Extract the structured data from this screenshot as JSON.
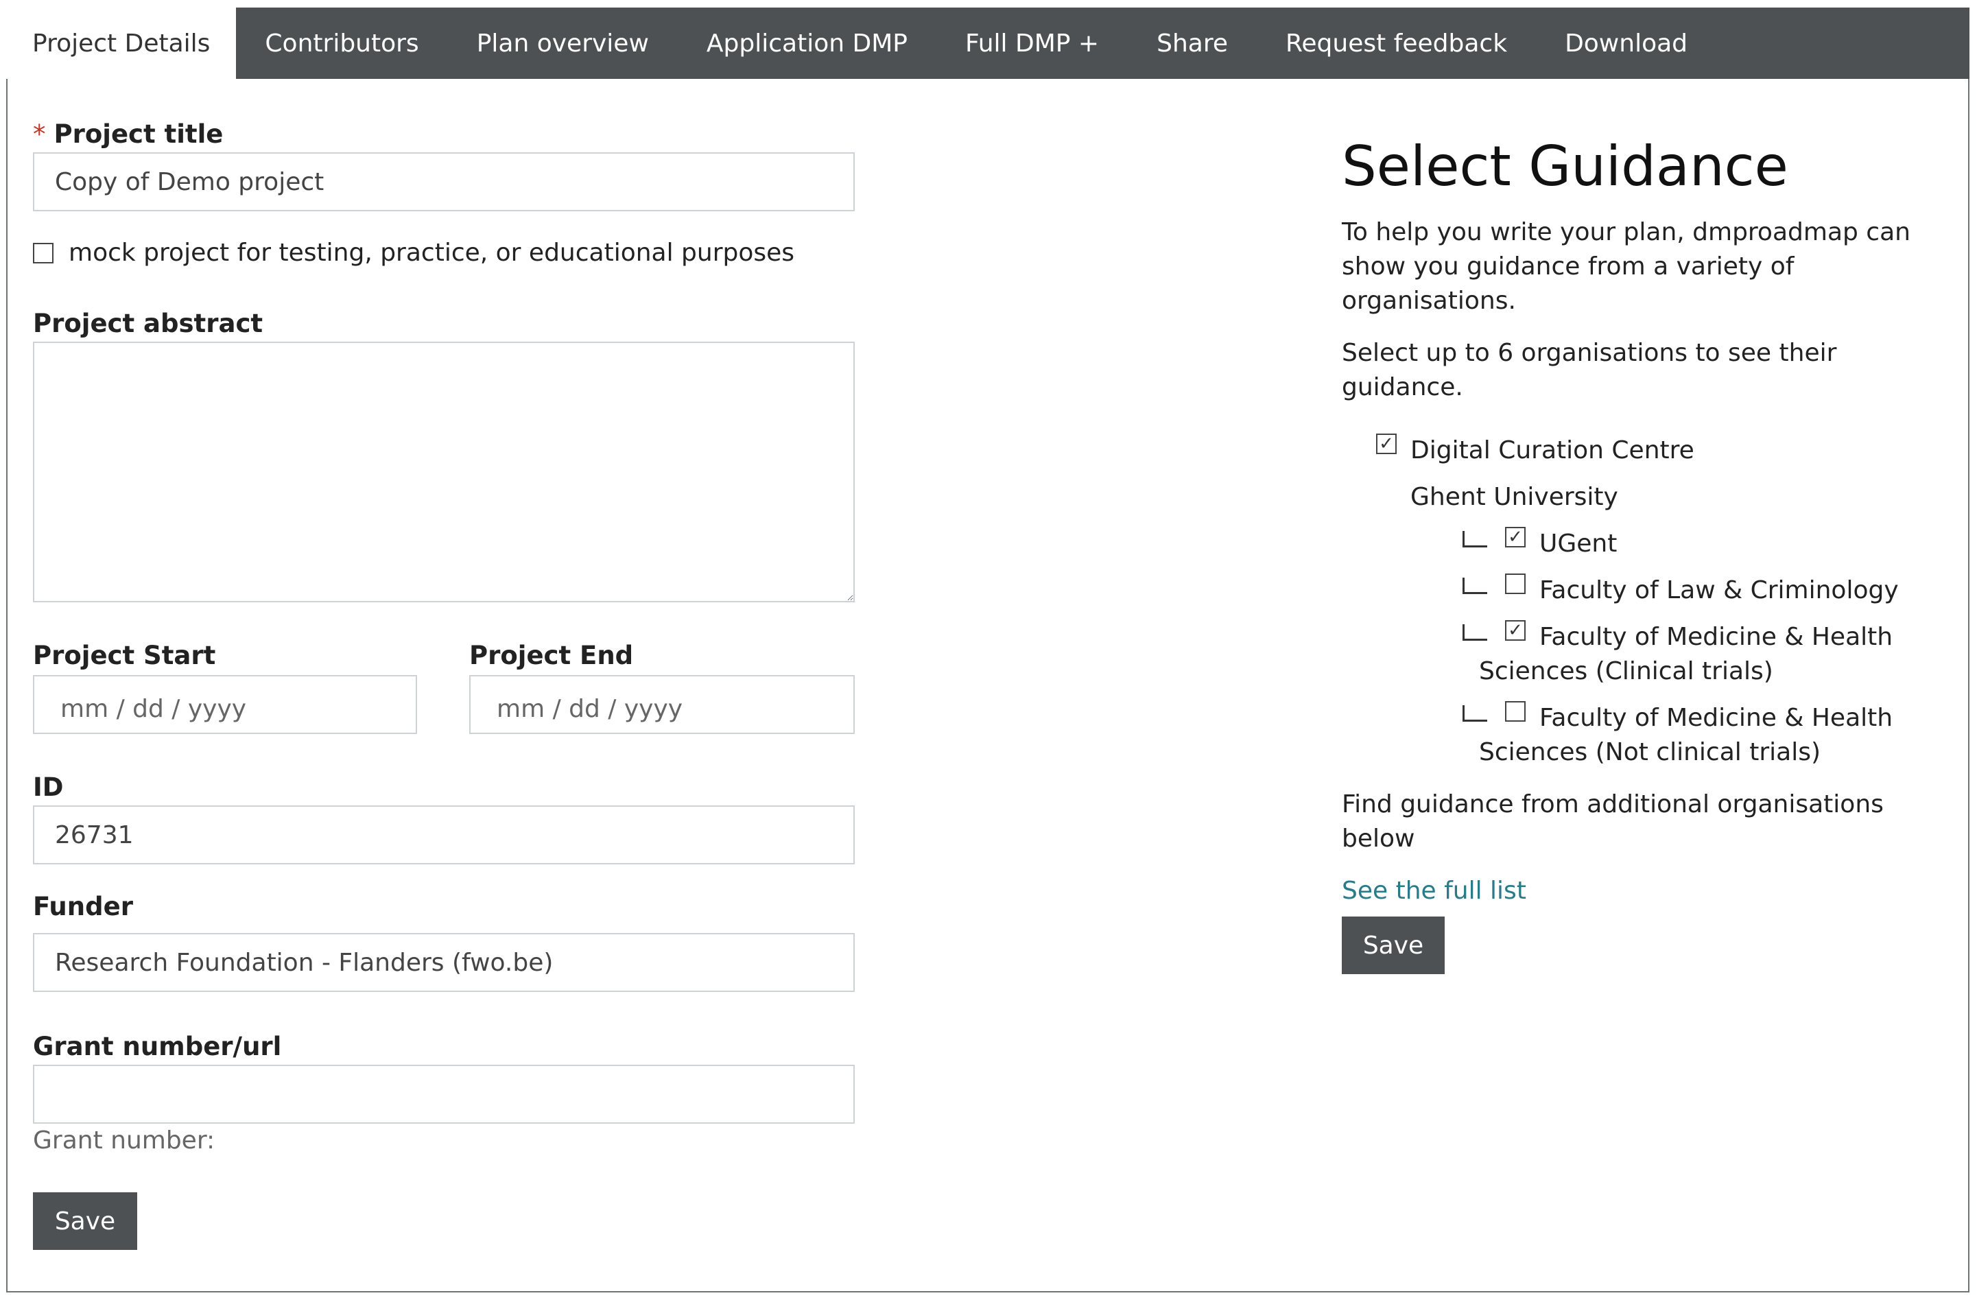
{
  "tabs": [
    {
      "label": "Project Details",
      "active": true
    },
    {
      "label": "Contributors"
    },
    {
      "label": "Plan overview"
    },
    {
      "label": "Application DMP"
    },
    {
      "label": "Full DMP +"
    },
    {
      "label": "Share"
    },
    {
      "label": "Request feedback"
    },
    {
      "label": "Download"
    }
  ],
  "project_form": {
    "required_marker": "*",
    "title_label": "Project title",
    "title_value": "Copy of Demo project",
    "mock_checkbox_label": "mock project for testing, practice, or educational purposes",
    "abstract_label": "Project abstract",
    "start_label": "Project Start",
    "start_placeholder": "mm / dd / yyyy",
    "end_label": "Project End",
    "end_placeholder": "mm / dd / yyyy",
    "id_label": "ID",
    "id_value": "26731",
    "funder_label": "Funder",
    "funder_value": "Research Foundation - Flanders (fwo.be)",
    "grant_label": "Grant number/url",
    "grant_value": "",
    "grant_hint": "Grant number:",
    "save_label": "Save"
  },
  "guidance": {
    "title": "Select Guidance",
    "intro_line1": "To help you write your plan, dmproadmap can",
    "intro_line2": "show you guidance from a variety of",
    "intro_line3": "organisations.",
    "select_line1": "Select up to 6 organisations to see their",
    "select_line2": "guidance.",
    "options": [
      {
        "label": "Digital Curation Centre",
        "checked": true
      },
      {
        "group": "Ghent University"
      },
      {
        "label": "UGent",
        "checked": true
      },
      {
        "label": "Faculty of Law & Criminology",
        "checked": false
      },
      {
        "label_line1": "Faculty of Medicine & Health",
        "label_line2": "Sciences (Clinical trials)",
        "checked": true
      },
      {
        "label_line1": "Faculty of Medicine & Health",
        "label_line2": "Sciences (Not clinical trials)",
        "checked": false
      }
    ],
    "find_line1": "Find guidance from additional organisations",
    "find_line2": "below",
    "see_full_list": "See the full list",
    "save_label": "Save",
    "check_glyph": "✓"
  }
}
